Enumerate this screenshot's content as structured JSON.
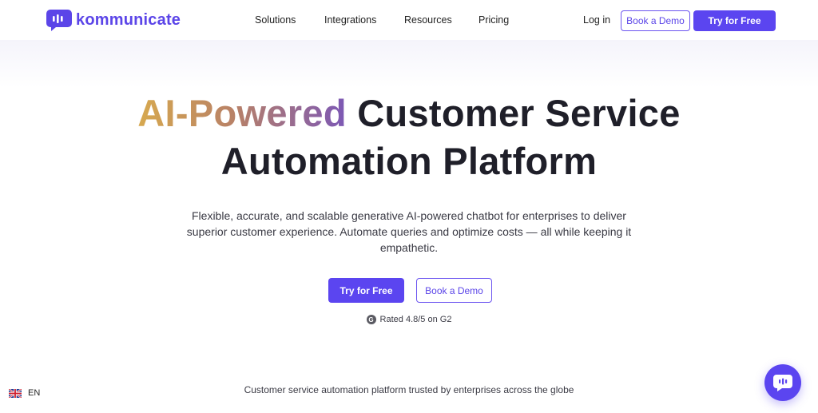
{
  "brand": {
    "name": "kommunicate",
    "color": "#5b45e8"
  },
  "nav": {
    "items": [
      {
        "label": "Solutions"
      },
      {
        "label": "Integrations"
      },
      {
        "label": "Resources"
      },
      {
        "label": "Pricing"
      }
    ],
    "login_label": "Log in",
    "book_demo_label": "Book a Demo",
    "try_free_label": "Try for Free"
  },
  "hero": {
    "headline_accent": "AI-Powered",
    "headline_rest": "Customer Service",
    "headline_line2": "Automation Platform",
    "subtext": "Flexible, accurate, and scalable generative AI-powered chatbot for enterprises to deliver superior customer experience. Automate queries and optimize costs — all while keeping it empathetic.",
    "primary_cta": "Try for Free",
    "secondary_cta": "Book a Demo",
    "rating": "Rated 4.8/5 on G2",
    "rating_icon": "G"
  },
  "trusted_text": "Customer service automation platform trusted by enterprises across the globe",
  "language": {
    "code": "EN",
    "icon": "uk-flag-icon"
  },
  "chat_widget": {
    "icon": "chat-bubble-icon"
  },
  "colors": {
    "accent": "#5b45f0",
    "headline_gradient": [
      "#d7a94f",
      "#b98266",
      "#7c58b5"
    ],
    "text": "#1f1f29"
  }
}
